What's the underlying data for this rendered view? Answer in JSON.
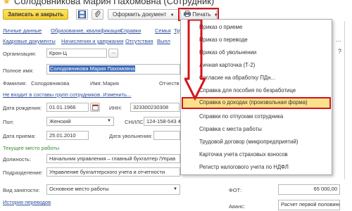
{
  "window": {
    "title": "Солодовникова Мария Пахомовна (Сотрудник)"
  },
  "toolbar": {
    "save_close": "Записать и закрыть",
    "create_document": "Оформить документ",
    "print": "Печать"
  },
  "nav": {
    "row1": [
      "Личные данные",
      "Образование, квалификация",
      "Справки",
      "Семья",
      "Труд"
    ],
    "row2": [
      "Кадровые документы",
      "Начисления и удержания",
      "Отсутствия",
      "Выпл"
    ]
  },
  "form": {
    "org_label": "Организация:",
    "org_value": "Крон-Ц",
    "fullname_label": "Полное имя:",
    "fullname_value": "Солодовникова Мария Пахомовна",
    "surname_label": "Фамилия:",
    "surname_value": "Солодовникова",
    "name_label": "Имя:",
    "name_value": "Мария",
    "patronymic_label": "Отчеств",
    "groups_link": "Не входит в составы групп сотрудников. Изменить...",
    "birth_label": "Дата рождения:",
    "birth_value": "01.01.1966",
    "inn_label": "ИНН:",
    "inn_value": "323300230308",
    "sex_label": "Пол:",
    "sex_value": "Женский",
    "snils_label": "СНИЛС:",
    "snils_value": "124-158-543 41",
    "hire_label": "Дата приема:",
    "hire_value": "25.01.2010",
    "fire_label": "Дата увольнения:",
    "current_job": "Текущее место работы",
    "position_label": "Должность:",
    "position_value": "Начальник управления – главный бухгалтер /Управ",
    "dept_label": "Подразделение:",
    "dept_value": "Управление бухгалтерского учета и отчетности",
    "emp_type_label": "Вид занятости:",
    "emp_type_value": "Основное место работы",
    "fot_label": "ФОТ:",
    "fot_value": "65 000,00",
    "history_link": "История переводов",
    "advance_label": "Аванс:",
    "advance_value": "Расчет первой половины"
  },
  "print_menu": {
    "items": [
      "Приказ о приеме",
      "Приказ о переводе",
      "Приказ об увольнении",
      "Личная карточка (Т-2)",
      "Согласие на обработку ПДн...",
      "Справка для пособия по безработице",
      "Справка о доходах (произвольная форма)",
      "Справки по отпускам сотрудника",
      "Справка с места работы",
      "Трудовой договор (микропредприятий)",
      "Карточка учета страховых взносов",
      "Регистр налогового учета по НДФЛ"
    ],
    "highlighted_index": 6
  },
  "colors": {
    "highlight_border": "#d4151d",
    "highlight_fill": "#fbe18a",
    "link": "#2d4f9e",
    "arrow": "#d4151d"
  }
}
